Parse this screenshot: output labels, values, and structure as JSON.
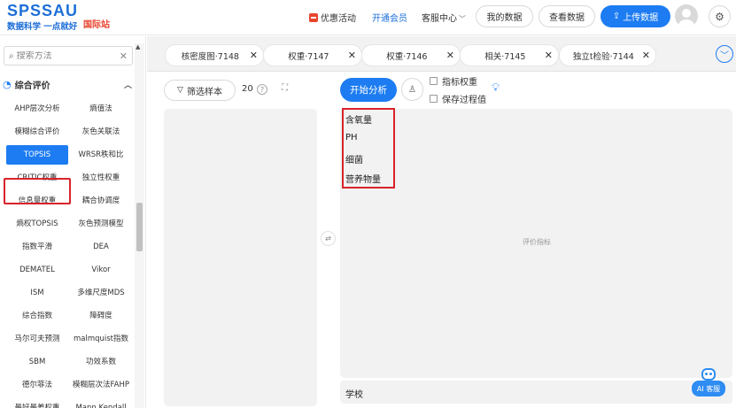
{
  "header": {
    "logo_text": "SPSSAU",
    "logo_sub": "数据科学 一点就好",
    "intl": "国际站",
    "promo": "优惠活动",
    "vip": "开通会员",
    "service": "客服中心",
    "my_data": "我的数据",
    "view_data": "查看数据",
    "upload": "上传数据"
  },
  "sidebar": {
    "search_placeholder": "搜索方法",
    "category": "综合评价",
    "methods": [
      "AHP层次分析",
      "熵值法",
      "模糊综合评价",
      "灰色关联法",
      "TOPSIS",
      "WRSR秩和比",
      "CRITIC权重",
      "独立性权重",
      "信息量权重",
      "耦合协调度",
      "熵权TOPSIS",
      "灰色预测模型",
      "指数平滑",
      "DEA",
      "DEMATEL",
      "Vikor",
      "ISM",
      "多维尺度MDS",
      "综合指数",
      "障碍度",
      "马尔可夫预测",
      "malmquist指数",
      "SBM",
      "功效系数",
      "德尔菲法",
      "模糊层次法FAHP",
      "最好最差权重",
      "Mann Kendall"
    ],
    "active_method": "TOPSIS"
  },
  "tabs": [
    {
      "label": "核密度图·7148"
    },
    {
      "label": "权重·7147"
    },
    {
      "label": "权重·7146"
    },
    {
      "label": "相关·7145"
    },
    {
      "label": "独立t检验·7144"
    }
  ],
  "workspace": {
    "filter_button": "筛选样本",
    "sample_count": "20",
    "start_button": "开始分析",
    "option_weights": "指标权重",
    "option_process": "保存过程值",
    "right_panel_label": "评价指标",
    "variables": [
      "含氧量",
      "PH",
      "细菌",
      "营养物量"
    ],
    "bottom_field": "学校",
    "ai_label": "AI 客服"
  },
  "colors": {
    "brand": "#1d7cf2",
    "highlight": "#d8232a",
    "intl": "#e8442e"
  }
}
